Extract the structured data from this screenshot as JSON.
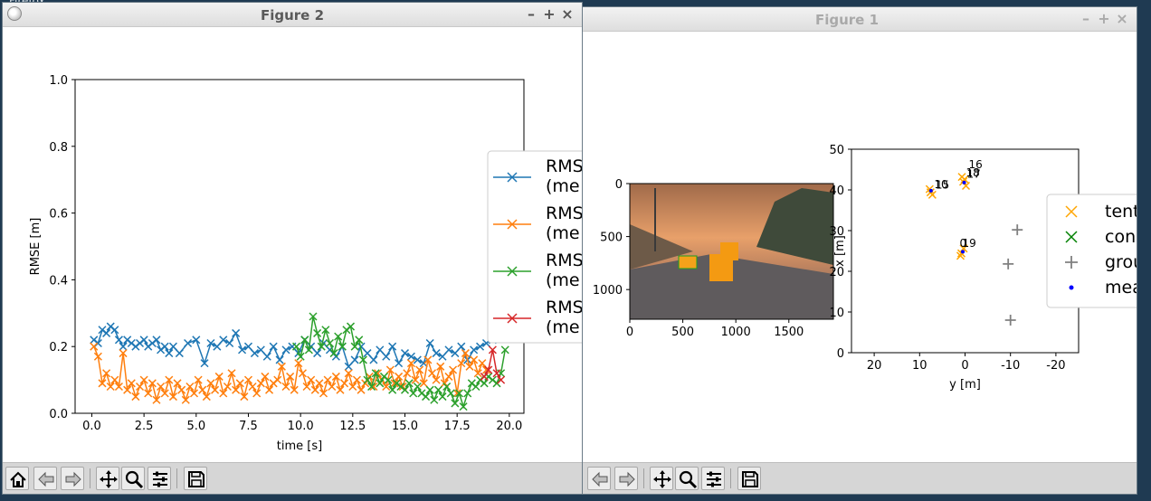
{
  "desktop": {
    "top_label": "Firefox"
  },
  "windows": {
    "figure2": {
      "title": "Figure 2"
    },
    "figure1": {
      "title": "Figure 1"
    }
  },
  "window_buttons": {
    "minimize": "–",
    "maximize": "+",
    "close": "×"
  },
  "colors": {
    "tab_blue": "#1f77b4",
    "tab_orange": "#ff7f0e",
    "tab_green": "#2ca02c",
    "tab_red": "#d62728",
    "tentative": "orange",
    "confirmed": "green",
    "ground_truth": "gray",
    "measurement": "blue"
  },
  "toolbar": {
    "figure2": [
      "home-icon",
      "back-arrow-icon",
      "forward-arrow-icon",
      "pan-icon",
      "zoom-icon",
      "configure-icon",
      "save-icon"
    ],
    "figure1": [
      "back-arrow-icon",
      "forward-arrow-icon",
      "pan-icon",
      "zoom-icon",
      "configure-icon",
      "save-icon"
    ]
  },
  "chart_data": [
    {
      "id": "rmse",
      "type": "line",
      "xlabel": "time [s]",
      "ylabel": "RMSE [m]",
      "xlim": [
        -0.8,
        20.7
      ],
      "ylim": [
        0,
        1
      ],
      "xticks": [
        "0.0",
        "2.5",
        "5.0",
        "7.5",
        "10.0",
        "12.5",
        "15.0",
        "17.5",
        "20.0"
      ],
      "yticks": [
        "0.0",
        "0.2",
        "0.4",
        "0.6",
        "0.8",
        "1.0"
      ],
      "legend_position": "right (clipped)",
      "legend": [
        {
          "line1": "RMS",
          "line2": "(me"
        },
        {
          "line1": "RMS",
          "line2": "(me"
        },
        {
          "line1": "RMS",
          "line2": "(me"
        },
        {
          "line1": "RMS",
          "line2": "(me"
        }
      ],
      "series": [
        {
          "color": "#1f77b4",
          "marker": "x",
          "x": [
            0.1,
            0.3,
            0.5,
            0.7,
            0.9,
            1.1,
            1.3,
            1.5,
            1.7,
            1.9,
            2.1,
            2.3,
            2.5,
            2.7,
            2.9,
            3.1,
            3.3,
            3.5,
            3.7,
            3.9,
            4.2,
            4.6,
            5.0,
            5.4,
            5.7,
            6.0,
            6.3,
            6.6,
            6.9,
            7.2,
            7.5,
            7.8,
            8.1,
            8.4,
            8.7,
            9.0,
            9.3,
            9.6,
            9.9,
            10.2,
            10.5,
            10.8,
            11.1,
            11.4,
            11.7,
            12.0,
            12.3,
            12.6,
            12.9,
            13.2,
            13.5,
            13.8,
            14.1,
            14.4,
            14.7,
            15.0,
            15.3,
            15.6,
            15.9,
            16.2,
            16.5,
            16.8,
            17.1,
            17.4,
            17.7,
            18.0,
            18.3,
            18.6,
            18.9,
            19.2
          ],
          "y": [
            0.22,
            0.21,
            0.25,
            0.24,
            0.26,
            0.25,
            0.22,
            0.2,
            0.22,
            0.21,
            0.2,
            0.21,
            0.22,
            0.2,
            0.21,
            0.22,
            0.19,
            0.2,
            0.18,
            0.2,
            0.18,
            0.21,
            0.22,
            0.15,
            0.21,
            0.2,
            0.22,
            0.21,
            0.24,
            0.19,
            0.2,
            0.18,
            0.19,
            0.17,
            0.2,
            0.16,
            0.19,
            0.2,
            0.18,
            0.22,
            0.2,
            0.18,
            0.21,
            0.19,
            0.17,
            0.2,
            0.14,
            0.16,
            0.2,
            0.18,
            0.16,
            0.19,
            0.17,
            0.2,
            0.15,
            0.18,
            0.17,
            0.16,
            0.15,
            0.21,
            0.18,
            0.17,
            0.19,
            0.18,
            0.2,
            0.16,
            0.19,
            0.2,
            0.21,
            0.22
          ]
        },
        {
          "color": "#ff7f0e",
          "marker": "x",
          "x": [
            0.1,
            0.3,
            0.5,
            0.7,
            0.9,
            1.1,
            1.3,
            1.5,
            1.7,
            1.9,
            2.1,
            2.3,
            2.5,
            2.7,
            2.9,
            3.1,
            3.3,
            3.5,
            3.7,
            3.9,
            4.1,
            4.3,
            4.5,
            4.7,
            4.9,
            5.1,
            5.3,
            5.5,
            5.7,
            5.9,
            6.1,
            6.3,
            6.5,
            6.7,
            6.9,
            7.1,
            7.3,
            7.5,
            7.7,
            7.9,
            8.1,
            8.3,
            8.5,
            8.7,
            8.9,
            9.1,
            9.3,
            9.5,
            9.7,
            9.9,
            10.1,
            10.3,
            10.5,
            10.7,
            10.9,
            11.1,
            11.3,
            11.5,
            11.7,
            11.9,
            12.1,
            12.3,
            12.5,
            12.7,
            12.9,
            13.1,
            13.3,
            13.5,
            13.7,
            13.9,
            14.1,
            14.3,
            14.5,
            14.7,
            14.9,
            15.1,
            15.3,
            15.5,
            15.7,
            15.9,
            16.1,
            16.3,
            16.5,
            16.7,
            16.9,
            17.1,
            17.3,
            17.5,
            17.7,
            17.9,
            18.1,
            18.3,
            18.5,
            18.7,
            18.9
          ],
          "y": [
            0.2,
            0.17,
            0.09,
            0.12,
            0.08,
            0.1,
            0.08,
            0.18,
            0.07,
            0.09,
            0.05,
            0.08,
            0.1,
            0.06,
            0.09,
            0.04,
            0.08,
            0.06,
            0.1,
            0.05,
            0.09,
            0.07,
            0.04,
            0.08,
            0.06,
            0.1,
            0.07,
            0.05,
            0.09,
            0.07,
            0.11,
            0.06,
            0.08,
            0.12,
            0.07,
            0.09,
            0.05,
            0.1,
            0.08,
            0.06,
            0.09,
            0.11,
            0.07,
            0.09,
            0.1,
            0.14,
            0.08,
            0.11,
            0.07,
            0.15,
            0.12,
            0.08,
            0.1,
            0.07,
            0.09,
            0.06,
            0.1,
            0.08,
            0.11,
            0.07,
            0.09,
            0.12,
            0.08,
            0.1,
            0.07,
            0.09,
            0.11,
            0.08,
            0.12,
            0.1,
            0.08,
            0.13,
            0.09,
            0.11,
            0.08,
            0.12,
            0.15,
            0.1,
            0.13,
            0.09,
            0.16,
            0.12,
            0.1,
            0.14,
            0.09,
            0.11,
            0.13,
            0.06,
            0.15,
            0.18,
            0.14,
            0.16,
            0.12,
            0.15,
            0.13
          ]
        },
        {
          "color": "#2ca02c",
          "marker": "x",
          "x": [
            9.8,
            10.0,
            10.2,
            10.4,
            10.6,
            10.8,
            11.0,
            11.2,
            11.4,
            11.6,
            11.8,
            12.0,
            12.2,
            12.4,
            12.6,
            12.8,
            13.0,
            13.2,
            13.4,
            13.6,
            13.8,
            14.0,
            14.2,
            14.4,
            14.6,
            14.8,
            15.0,
            15.2,
            15.4,
            15.6,
            15.8,
            16.0,
            16.2,
            16.4,
            16.6,
            16.8,
            17.0,
            17.2,
            17.4,
            17.6,
            17.8,
            18.0,
            18.2,
            18.4,
            18.6,
            18.8,
            19.0,
            19.2,
            19.4,
            19.6,
            19.8
          ],
          "y": [
            0.2,
            0.17,
            0.22,
            0.19,
            0.29,
            0.24,
            0.2,
            0.25,
            0.21,
            0.18,
            0.23,
            0.2,
            0.25,
            0.26,
            0.2,
            0.22,
            0.16,
            0.1,
            0.08,
            0.12,
            0.09,
            0.11,
            0.1,
            0.07,
            0.09,
            0.08,
            0.07,
            0.09,
            0.06,
            0.08,
            0.06,
            0.05,
            0.07,
            0.04,
            0.07,
            0.05,
            0.08,
            0.06,
            0.03,
            0.06,
            0.02,
            0.06,
            0.09,
            0.08,
            0.1,
            0.09,
            0.11,
            0.1,
            0.09,
            0.12,
            0.19
          ]
        },
        {
          "color": "#d62728",
          "marker": "x",
          "x": [
            18.8,
            19.0,
            19.2,
            19.4,
            19.6
          ],
          "y": [
            0.11,
            0.13,
            0.19,
            0.12,
            0.1
          ]
        }
      ]
    },
    {
      "id": "camera",
      "type": "image",
      "xticks": [
        "0",
        "500",
        "1000",
        "1500"
      ],
      "yticks": [
        "0",
        "500",
        "1000"
      ],
      "xlim": [
        0,
        1920
      ],
      "ylim": [
        1280,
        0
      ]
    },
    {
      "id": "birdseye",
      "type": "scatter",
      "xlabel": "y [m]",
      "ylabel": "x [m]",
      "xlim": [
        25,
        -25
      ],
      "ylim": [
        0,
        50
      ],
      "xticks": [
        "20",
        "10",
        "0",
        "-10",
        "-20"
      ],
      "yticks": [
        "0",
        "10",
        "20",
        "30",
        "40",
        "50"
      ],
      "legend_position": "right (clipped)",
      "legend": [
        {
          "label": "tent",
          "marker": "x",
          "color": "orange"
        },
        {
          "label": "con",
          "marker": "x",
          "color": "green"
        },
        {
          "label": "grou",
          "marker": "+",
          "color": "gray"
        },
        {
          "label": "mea",
          "marker": "dot",
          "color": "blue"
        }
      ],
      "series": [
        {
          "name": "tentative",
          "color": "orange",
          "marker": "x",
          "points": [
            [
              7.6,
              39.4
            ],
            [
              7.8,
              40.2
            ],
            [
              7.2,
              38.8
            ],
            [
              0.8,
              24.4
            ],
            [
              0.3,
              25.6
            ],
            [
              1.0,
              23.8
            ],
            [
              0.4,
              42.0
            ],
            [
              0.7,
              43.2
            ],
            [
              -0.2,
              41.0
            ],
            [
              0.1,
              42.6
            ]
          ]
        },
        {
          "name": "ground truth",
          "color": "gray",
          "marker": "+",
          "points": [
            [
              -11.5,
              30.2
            ],
            [
              -9.5,
              21.8
            ],
            [
              -10.0,
              8.0
            ]
          ]
        },
        {
          "name": "measurements",
          "color": "blue",
          "marker": "dot",
          "points": [
            [
              7.5,
              39.8
            ],
            [
              0.5,
              24.8
            ],
            [
              0.2,
              41.8
            ]
          ]
        }
      ],
      "annotations": [
        {
          "text": "10",
          "x": 6.8,
          "y": 40.5
        },
        {
          "text": "15",
          "x": 6.5,
          "y": 40.3
        },
        {
          "text": "16",
          "x": -0.8,
          "y": 45.3
        },
        {
          "text": "18",
          "x": -0.2,
          "y": 43.3
        },
        {
          "text": "17",
          "x": -0.4,
          "y": 43.0
        },
        {
          "text": "0",
          "x": 1.2,
          "y": 26.0
        },
        {
          "text": "19",
          "x": 0.6,
          "y": 26.0
        }
      ]
    }
  ]
}
